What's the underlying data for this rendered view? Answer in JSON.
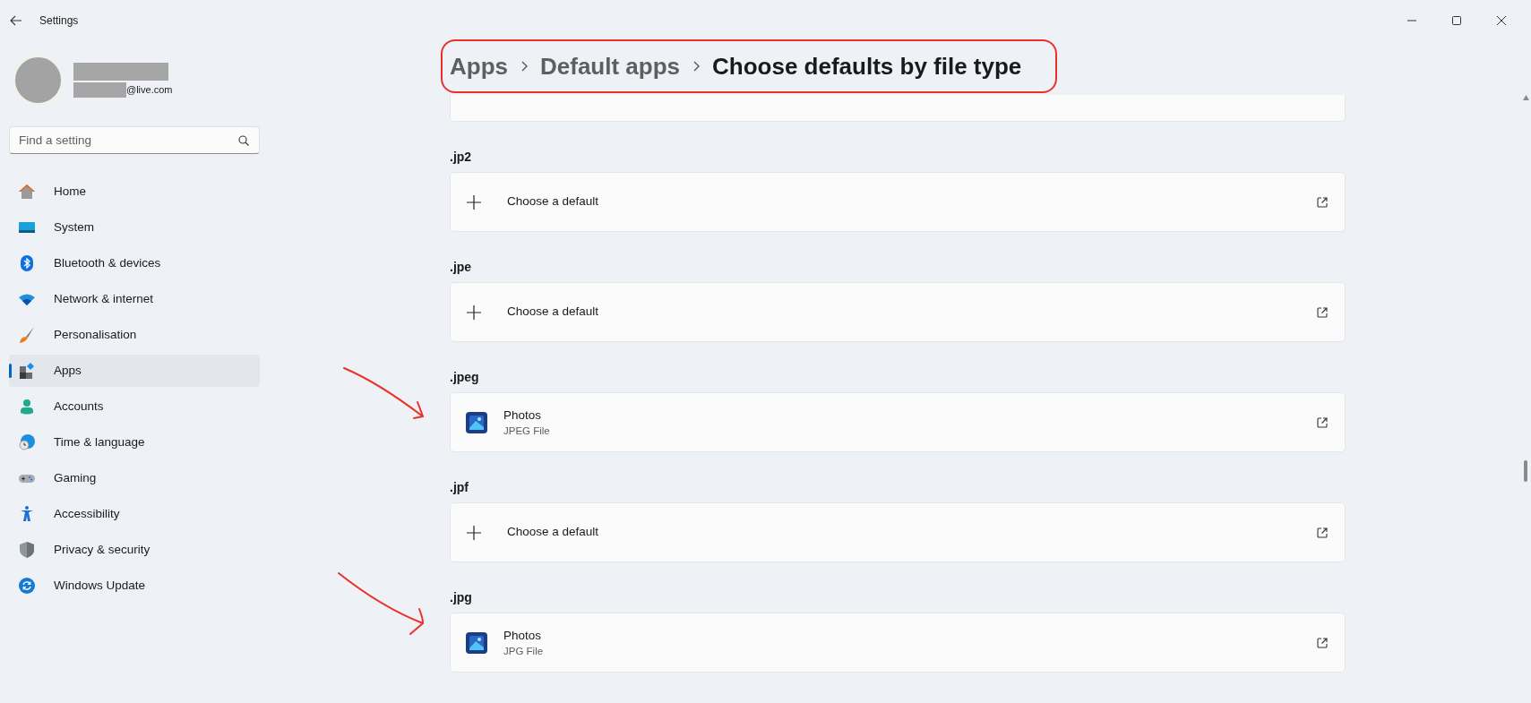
{
  "window": {
    "title": "Settings"
  },
  "account": {
    "email": "@live.com"
  },
  "search": {
    "placeholder": "Find a setting"
  },
  "nav": [
    {
      "label": "Home",
      "kind": "home",
      "selected": false
    },
    {
      "label": "System",
      "kind": "system",
      "selected": false
    },
    {
      "label": "Bluetooth & devices",
      "kind": "bluetooth",
      "selected": false
    },
    {
      "label": "Network & internet",
      "kind": "network",
      "selected": false
    },
    {
      "label": "Personalisation",
      "kind": "brush",
      "selected": false
    },
    {
      "label": "Apps",
      "kind": "apps",
      "selected": true
    },
    {
      "label": "Accounts",
      "kind": "accounts",
      "selected": false
    },
    {
      "label": "Time & language",
      "kind": "time",
      "selected": false
    },
    {
      "label": "Gaming",
      "kind": "gaming",
      "selected": false
    },
    {
      "label": "Accessibility",
      "kind": "accessibility",
      "selected": false
    },
    {
      "label": "Privacy & security",
      "kind": "privacy",
      "selected": false
    },
    {
      "label": "Windows Update",
      "kind": "update",
      "selected": false
    }
  ],
  "breadcrumb": [
    {
      "label": "Apps",
      "current": false
    },
    {
      "label": "Default apps",
      "current": false
    },
    {
      "label": "Choose defaults by file type",
      "current": true
    }
  ],
  "file_types": [
    {
      "extension": ".jp2",
      "kind": "empty",
      "action": "Choose a default"
    },
    {
      "extension": ".jpe",
      "kind": "empty",
      "action": "Choose a default"
    },
    {
      "extension": ".jpeg",
      "kind": "app",
      "app": "Photos",
      "description": "JPEG File"
    },
    {
      "extension": ".jpf",
      "kind": "empty",
      "action": "Choose a default"
    },
    {
      "extension": ".jpg",
      "kind": "app",
      "app": "Photos",
      "description": "JPG File"
    }
  ]
}
